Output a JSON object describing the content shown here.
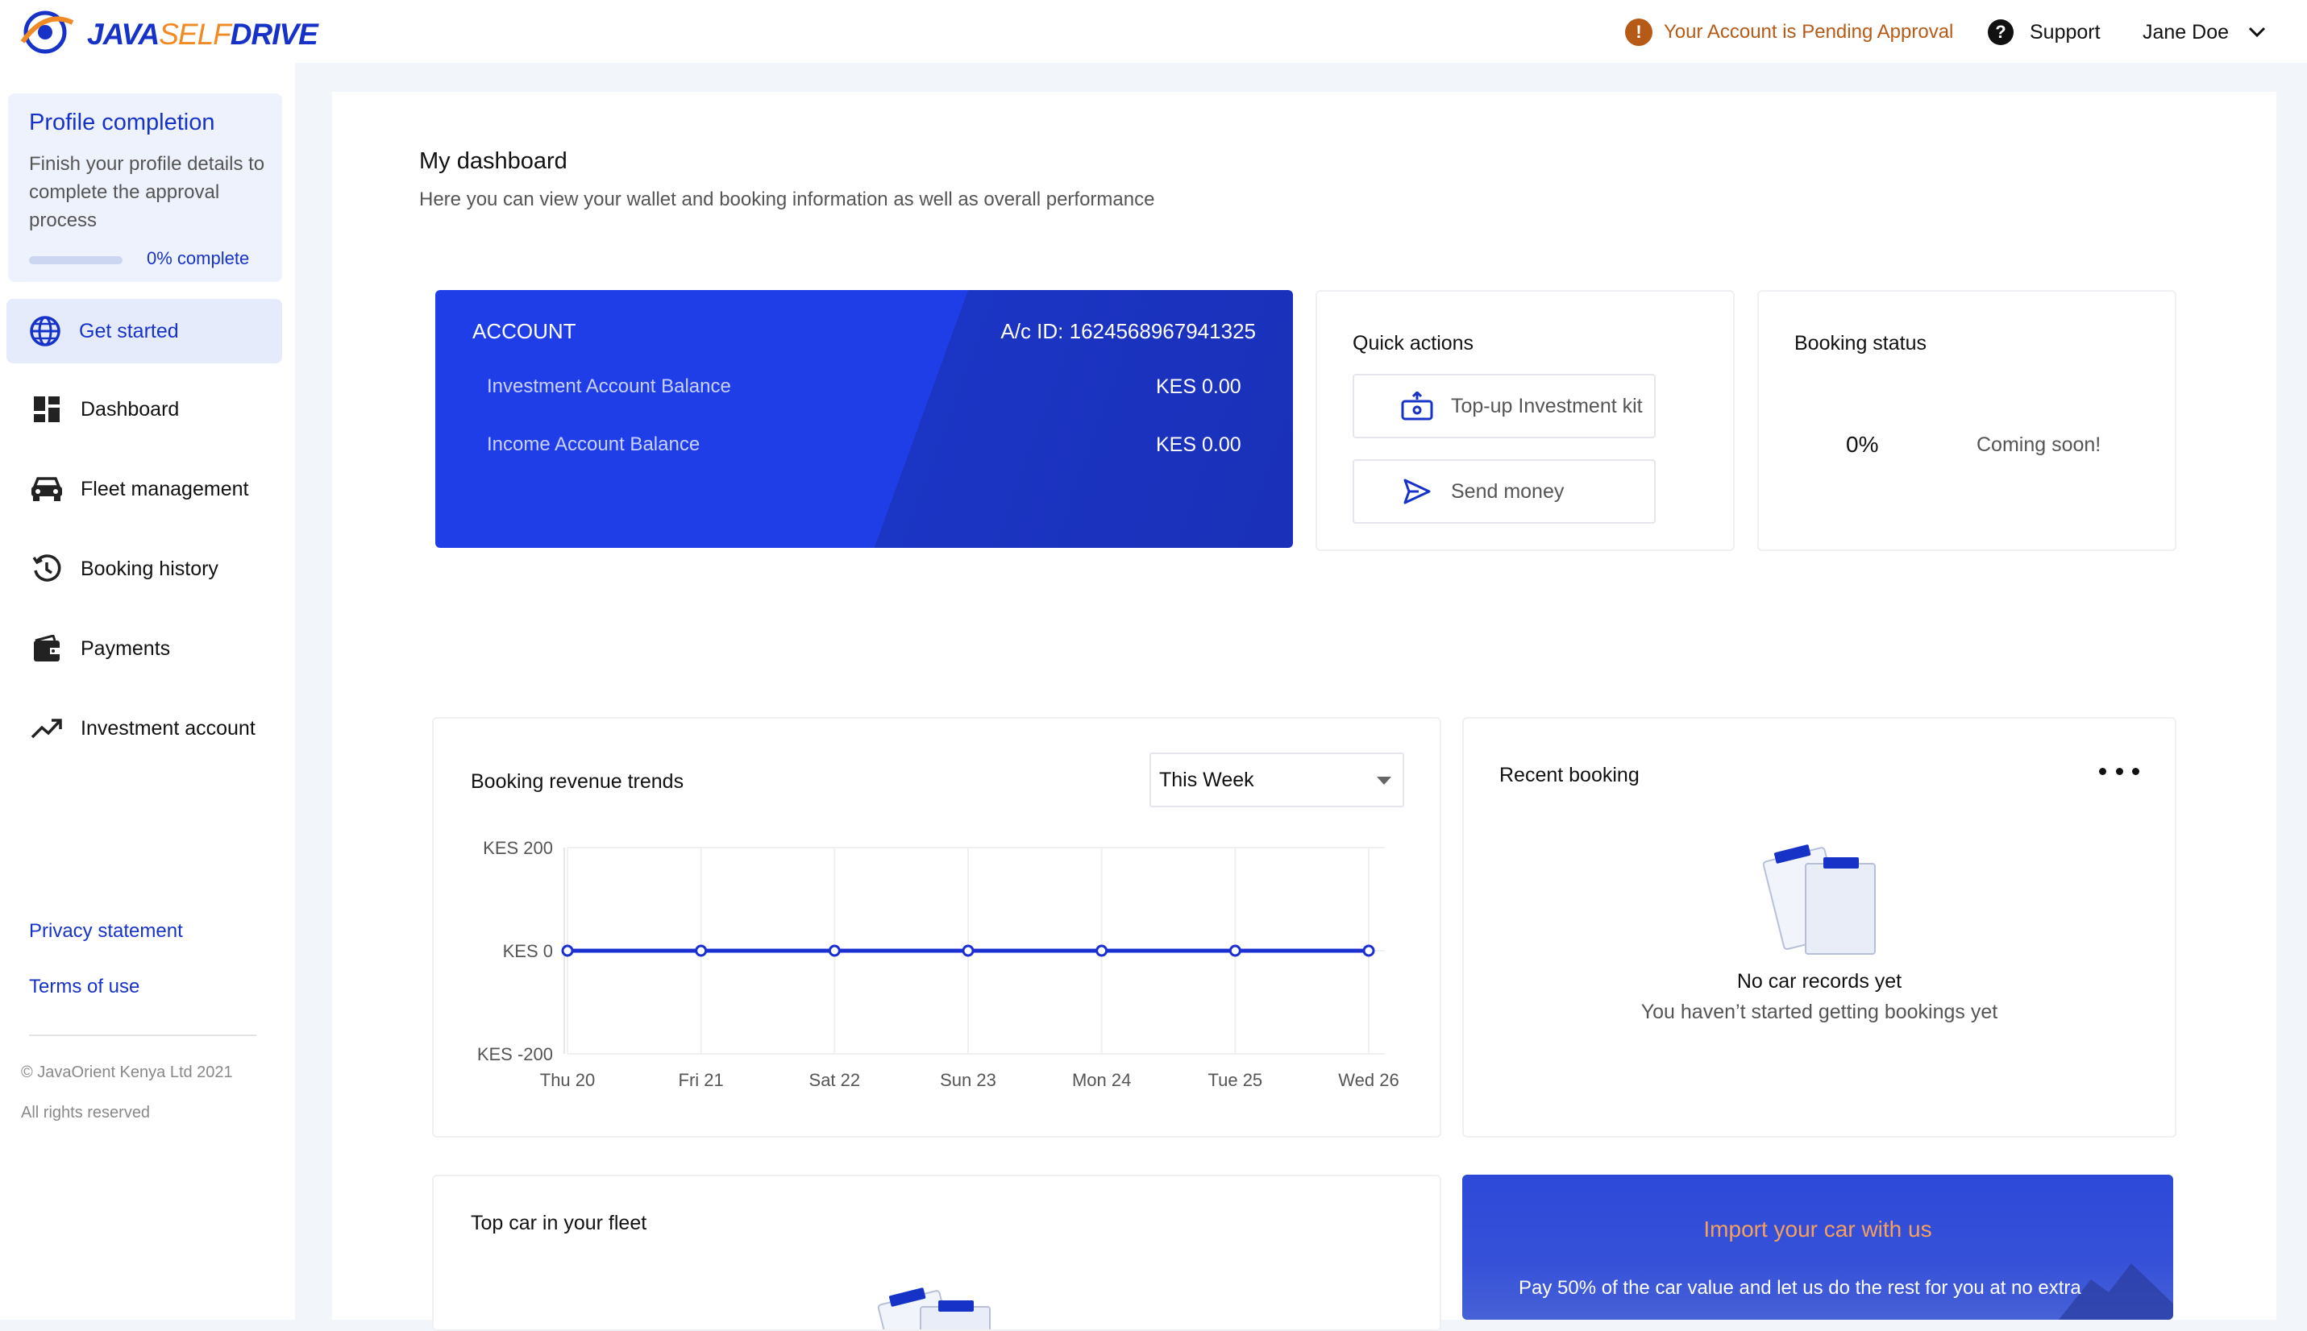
{
  "brand": {
    "name_left": "JAVA",
    "name_mid": "SELF",
    "name_right": "DRIVE"
  },
  "header": {
    "pending_text": "Your Account is Pending Approval",
    "support_label": "Support",
    "user_name": "Jane Doe"
  },
  "sidebar": {
    "profile": {
      "title": "Profile completion",
      "description": "Finish your profile details to complete the approval process",
      "progress_label": "0% complete",
      "progress": 0
    },
    "items": [
      {
        "label": "Get started",
        "icon": "globe-icon"
      },
      {
        "label": "Dashboard",
        "icon": "dashboard-icon"
      },
      {
        "label": "Fleet management",
        "icon": "car-icon"
      },
      {
        "label": "Booking history",
        "icon": "history-icon"
      },
      {
        "label": "Payments",
        "icon": "wallet-icon"
      },
      {
        "label": "Investment account",
        "icon": "trending-up-icon"
      }
    ],
    "privacy_label": "Privacy statement",
    "terms_label": "Terms of use",
    "copyright": "© JavaOrient Kenya Ltd 2021",
    "rights": "All rights reserved"
  },
  "dashboard": {
    "title": "My dashboard",
    "subtitle": "Here you can view your wallet and booking information as well as overall performance"
  },
  "account": {
    "label": "ACCOUNT",
    "account_id": "A/c ID: 1624568967941325",
    "investment_label": "Investment Account Balance",
    "investment_value": "KES 0.00",
    "income_label": "Income Account Balance",
    "income_value": "KES 0.00"
  },
  "quick_actions": {
    "title": "Quick actions",
    "topup_label": "Top-up Investment kit",
    "send_label": "Send money"
  },
  "booking_status": {
    "title": "Booking status",
    "percent": "0%",
    "note": "Coming soon!"
  },
  "revenue": {
    "title": "Booking revenue trends",
    "period": "This Week"
  },
  "chart_data": {
    "type": "line",
    "title": "Booking revenue trends",
    "x": [
      "Thu 20",
      "Fri 21",
      "Sat 22",
      "Sun 23",
      "Mon 24",
      "Tue 25",
      "Wed 26"
    ],
    "y_ticks": [
      "KES 200",
      "KES 0",
      "KES -200"
    ],
    "ylim": [
      -200,
      200
    ],
    "series": [
      {
        "values": [
          0,
          0,
          0,
          0,
          0,
          0,
          0
        ]
      }
    ],
    "grid": true,
    "color": "#1a2fd0"
  },
  "recent_booking": {
    "title": "Recent booking",
    "empty_title": "No car records yet",
    "empty_desc": "You haven’t started getting bookings yet"
  },
  "top_car": {
    "title": "Top car in your fleet"
  },
  "import": {
    "title": "Import your car with us",
    "description": "Pay 50% of the car value and let us do the rest for you at no extra"
  },
  "colors": {
    "primary": "#1733c7",
    "accent": "#f08a24",
    "warning": "#b55a17"
  }
}
